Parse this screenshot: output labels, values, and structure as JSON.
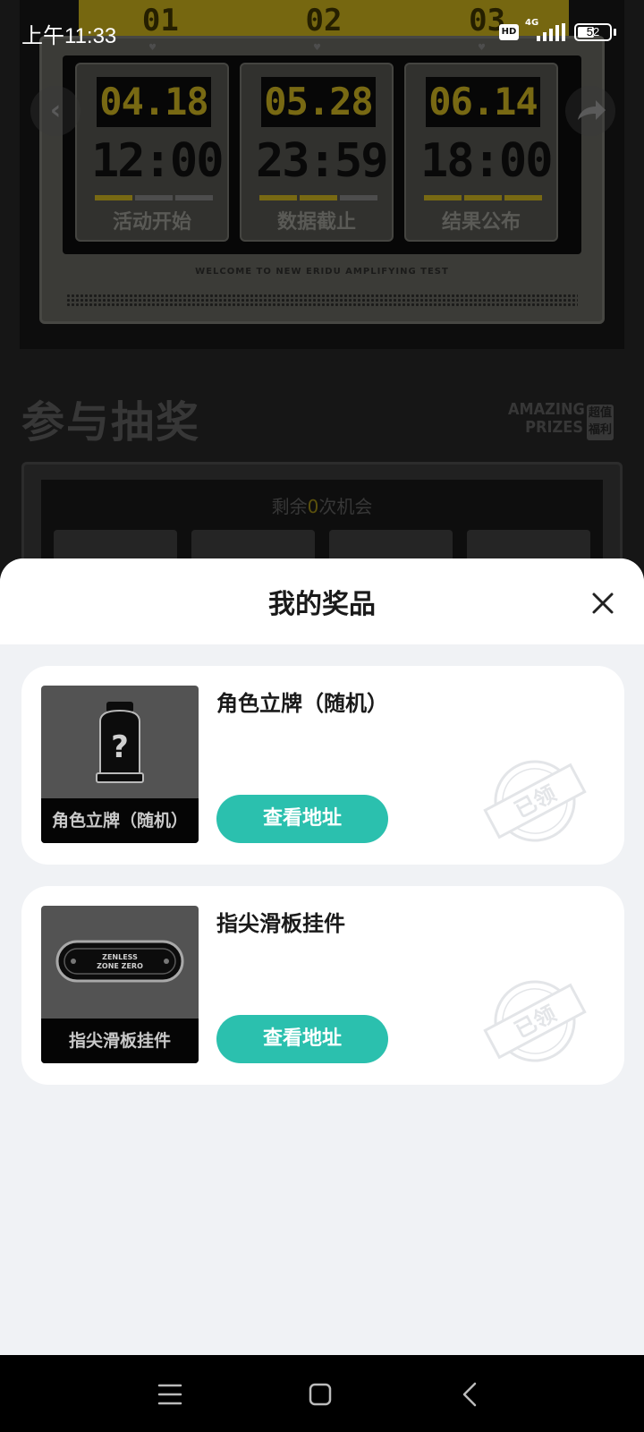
{
  "status_bar": {
    "time": "上午11:33",
    "hd": "HD",
    "network": "4G",
    "battery": "52",
    "battery_level": 0.52
  },
  "background": {
    "ruler_numbers": [
      "01",
      "02",
      "03"
    ],
    "dates": [
      {
        "date": "04.18",
        "time": "12:00",
        "label": "活动开始",
        "progress": 1
      },
      {
        "date": "05.28",
        "time": "23:59",
        "label": "数据截止",
        "progress": 2
      },
      {
        "date": "06.14",
        "time": "18:00",
        "label": "结果公布",
        "progress": 3
      }
    ],
    "welcome_text": "WELCOME TO NEW ERIDU AMPLIFYING TEST",
    "section_title": "参与抽奖",
    "amazing_line1": "AMAZING",
    "amazing_line2": "PRIZES",
    "amazing_tag": "超值福利",
    "chance_prefix": "剩余",
    "chance_count": "0",
    "chance_suffix": "次机会"
  },
  "sheet": {
    "title": "我的奖品",
    "prizes": [
      {
        "name": "角色立牌（随机）",
        "thumb_label": "角色立牌（随机）",
        "button": "查看地址",
        "stamp": "已领"
      },
      {
        "name": "指尖滑板挂件",
        "thumb_label": "指尖滑板挂件",
        "button": "查看地址",
        "stamp": "已领"
      }
    ],
    "skateboard_text_1": "ZENLESS",
    "skateboard_text_2": "ZONE ZERO"
  },
  "colors": {
    "accent": "#2bc0ae",
    "gold": "#b9a21e",
    "sheet_bg": "#f0f2f5"
  },
  "icons": [
    "back-arrow-icon",
    "share-icon",
    "close-icon",
    "menu-icon",
    "home-icon",
    "back-icon",
    "question-icon",
    "skateboard-icon",
    "claimed-stamp-icon"
  ]
}
